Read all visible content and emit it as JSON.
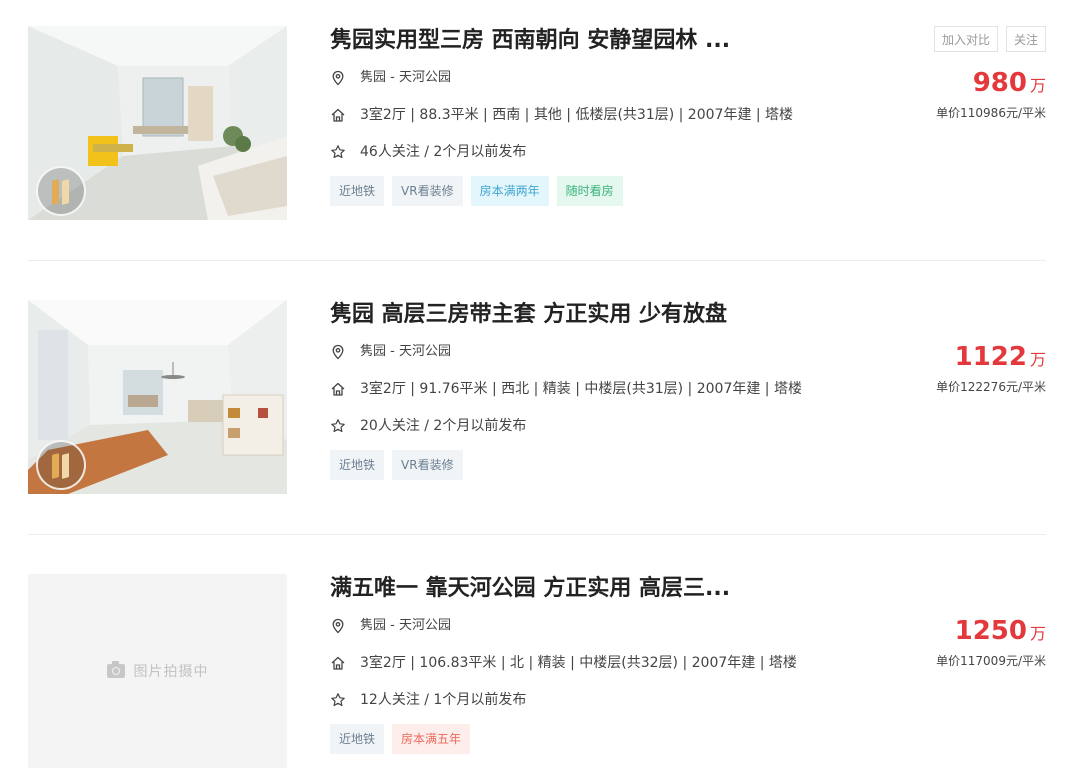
{
  "listings": [
    {
      "title": "隽园实用型三房 西南朝向 安静望园林 ...",
      "community": "隽园",
      "address_sep": "-",
      "district": "天河公园",
      "house_info": "3室2厅 | 88.3平米 | 西南 | 其他 | 低楼层(共31层) | 2007年建 | 塔楼",
      "follow_info": "46人关注 / 2个月以前发布",
      "tags": [
        "近地铁",
        "VR看装修",
        "房本满两年",
        "随时看房"
      ],
      "price": "980",
      "price_unit": "万",
      "unit_price": "单价110986元/平米",
      "has_photo": true,
      "has_vr": true
    },
    {
      "title": "隽园 高层三房带主套 方正实用 少有放盘",
      "community": "隽园",
      "address_sep": "-",
      "district": "天河公园",
      "house_info": "3室2厅 | 91.76平米 | 西北 | 精装 | 中楼层(共31层) | 2007年建 | 塔楼",
      "follow_info": "20人关注 / 2个月以前发布",
      "tags": [
        "近地铁",
        "VR看装修"
      ],
      "price": "1122",
      "price_unit": "万",
      "unit_price": "单价122276元/平米",
      "has_photo": true,
      "has_vr": true
    },
    {
      "title": "满五唯一 靠天河公园 方正实用 高层三...",
      "community": "隽园",
      "address_sep": "-",
      "district": "天河公园",
      "house_info": "3室2厅 | 106.83平米 | 北 | 精装 | 中楼层(共32层) | 2007年建 | 塔楼",
      "follow_info": "12人关注 / 1个月以前发布",
      "tags": [
        "近地铁",
        "房本满五年"
      ],
      "price": "1250",
      "price_unit": "万",
      "unit_price": "单价117009元/平米",
      "has_photo": false,
      "placeholder_text": "图片拍摄中"
    }
  ],
  "actions": {
    "compare_label": "加入对比",
    "follow_label": "关注"
  },
  "colors": {
    "price": "#e4393c",
    "tag_gray_bg": "#f1f4f7",
    "tag_blue_bg": "#e3f6fb",
    "tag_green_bg": "#e5f8ef",
    "tag_red_bg": "#fdeeec"
  },
  "icons": {
    "address": "location-pin-icon",
    "house": "house-icon",
    "follow": "star-icon",
    "vr": "vr-tour-icon",
    "placeholder": "camera-icon"
  }
}
